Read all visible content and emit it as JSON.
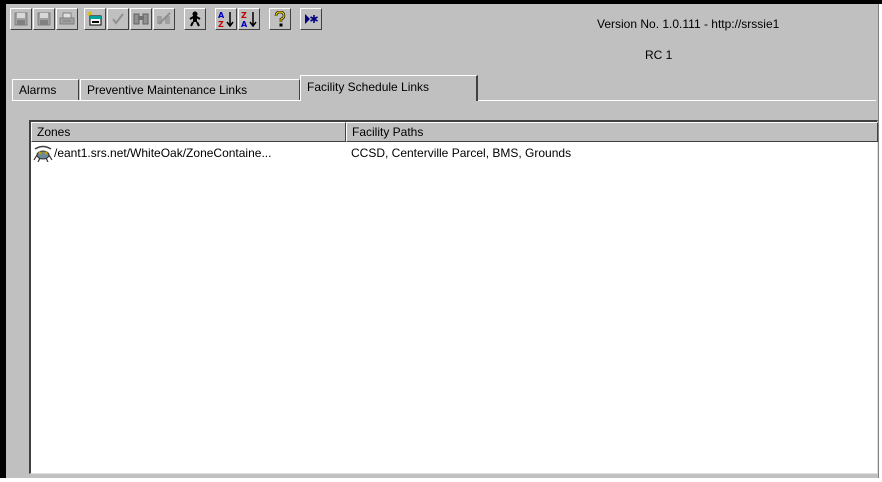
{
  "window": {
    "version_text": "Version No. 1.0.111 - http://srssie1",
    "rc_text": "RC 1"
  },
  "toolbar": {
    "buttons": [
      {
        "icon": "save-icon",
        "enabled": false
      },
      {
        "icon": "save-all-icon",
        "enabled": false
      },
      {
        "icon": "print-icon",
        "enabled": false
      },
      {
        "icon": "new-item-icon",
        "enabled": true
      },
      {
        "icon": "checkmark-icon",
        "enabled": false
      },
      {
        "icon": "binoculars-icon",
        "enabled": false
      },
      {
        "icon": "cancel-binoculars-icon",
        "enabled": false
      },
      {
        "icon": "link-person-icon",
        "enabled": true
      },
      {
        "icon": "sort-ascending-icon",
        "enabled": true
      },
      {
        "icon": "sort-descending-icon",
        "enabled": true
      },
      {
        "icon": "help-icon",
        "enabled": true
      },
      {
        "icon": "new-record-icon",
        "enabled": true
      }
    ]
  },
  "tabs": [
    {
      "label": "Alarms",
      "active": false
    },
    {
      "label": "Preventive Maintenance Links",
      "active": false
    },
    {
      "label": "Facility Schedule Links",
      "active": true
    }
  ],
  "table": {
    "columns": [
      "Zones",
      "Facility Paths"
    ],
    "rows": [
      {
        "icon": "zone-icon",
        "zone": "/eant1.srs.net/WhiteOak/ZoneContaine...",
        "facility_path": "CCSD, Centerville Parcel, BMS, Grounds"
      }
    ]
  },
  "colors": {
    "face": "#c0c0c0",
    "window_bg": "#ffffff",
    "frame": "#000000",
    "shadow": "#404040",
    "highlight": "#ffffff"
  }
}
